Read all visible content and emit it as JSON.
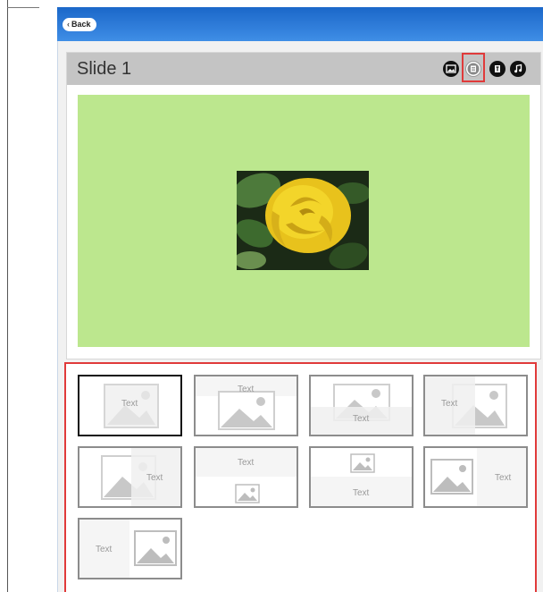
{
  "header": {
    "back_label": "Back"
  },
  "slide": {
    "title": "Slide 1",
    "tools": [
      {
        "name": "image-tool-icon"
      },
      {
        "name": "layout-tool-icon",
        "highlighted": true
      },
      {
        "name": "text-tool-icon"
      },
      {
        "name": "music-tool-icon"
      }
    ],
    "canvas_color": "#bce78e",
    "image_subject": "yellow rose"
  },
  "layouts": {
    "placeholder_text": "Text",
    "items": [
      {
        "id": "text-over-image",
        "label": "Text",
        "selected": true
      },
      {
        "id": "text-top-image",
        "label": "Text"
      },
      {
        "id": "image-text-bottom",
        "label": "Text"
      },
      {
        "id": "text-left-image-overlap",
        "label": "Text"
      },
      {
        "id": "image-left-text-right-overlap",
        "label": "Text"
      },
      {
        "id": "text-top-small-image",
        "label": "Text"
      },
      {
        "id": "small-image-text-bottom",
        "label": "Text"
      },
      {
        "id": "image-left-text-right",
        "label": "Text"
      },
      {
        "id": "text-left-image-right",
        "label": "Text"
      }
    ]
  },
  "colors": {
    "header_blue": "#2d7ad8",
    "highlight_red": "#e03a3a",
    "slide_bg": "#bce78e"
  }
}
